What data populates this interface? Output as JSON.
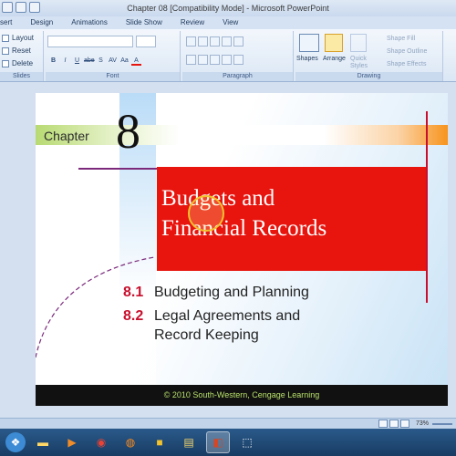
{
  "window": {
    "title": "Chapter 08 [Compatibility Mode] - Microsoft PowerPoint"
  },
  "tabs": [
    "sert",
    "Design",
    "Animations",
    "Slide Show",
    "Review",
    "View"
  ],
  "ribbon": {
    "slides": {
      "layout": "Layout",
      "reset": "Reset",
      "delete": "Delete",
      "label": "Slides"
    },
    "font": {
      "label": "Font",
      "buttons": [
        "B",
        "I",
        "U",
        "abe",
        "S",
        "AV",
        "Aa",
        "A"
      ]
    },
    "paragraph": {
      "label": "Paragraph"
    },
    "drawing": {
      "label": "Drawing",
      "shapes": "Shapes",
      "arrange": "Arrange",
      "quick_styles": "Quick Styles",
      "shape_fill": "Shape Fill",
      "shape_outline": "Shape Outline",
      "shape_effects": "Shape Effects"
    }
  },
  "slide": {
    "chapter_label": "Chapter",
    "chapter_number": "8",
    "title_line1": "Budgets and",
    "title_line2": "Financial Records",
    "items": [
      {
        "num": "8.1",
        "text": "Budgeting and Planning"
      },
      {
        "num": "8.2",
        "text": "Legal Agreements and"
      },
      {
        "num": "",
        "text": "Record Keeping"
      }
    ],
    "footer": "© 2010 South-Western, Cengage Learning"
  },
  "statusbar": {
    "zoom": "73%"
  },
  "colors": {
    "accent_red": "#e8140e",
    "ribbon_blue": "#dbe7f5",
    "footer_green": "#b7e06a"
  }
}
